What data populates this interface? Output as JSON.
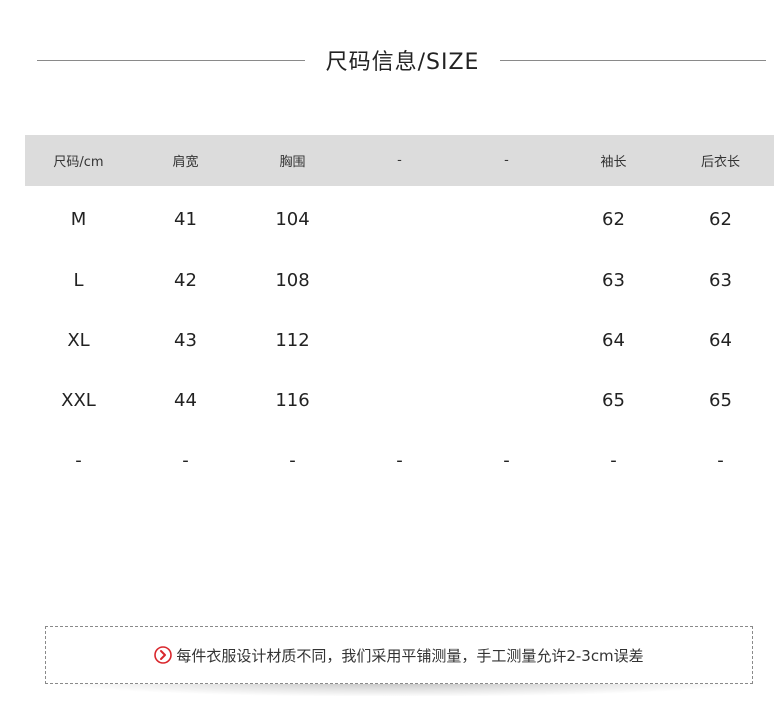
{
  "title": "尺码信息/SIZE",
  "table": {
    "headers": [
      "尺码/cm",
      "肩宽",
      "胸围",
      "-",
      "-",
      "袖长",
      "后衣长"
    ],
    "rows": [
      [
        "M",
        "41",
        "104",
        "",
        "",
        "62",
        "62"
      ],
      [
        "L",
        "42",
        "108",
        "",
        "",
        "63",
        "63"
      ],
      [
        "XL",
        "43",
        "112",
        "",
        "",
        "64",
        "64"
      ],
      [
        "XXL",
        "44",
        "116",
        "",
        "",
        "65",
        "65"
      ],
      [
        "-",
        "-",
        "-",
        "-",
        "-",
        "-",
        "-"
      ]
    ]
  },
  "note": {
    "icon": "chevron-right-circle-icon",
    "icon_color": "#d9262c",
    "text": "每件衣服设计材质不同，我们采用平铺测量，手工测量允许2-3cm误差"
  },
  "colors": {
    "header_bg": "#dcdcdc",
    "line": "#8a8a8a"
  }
}
